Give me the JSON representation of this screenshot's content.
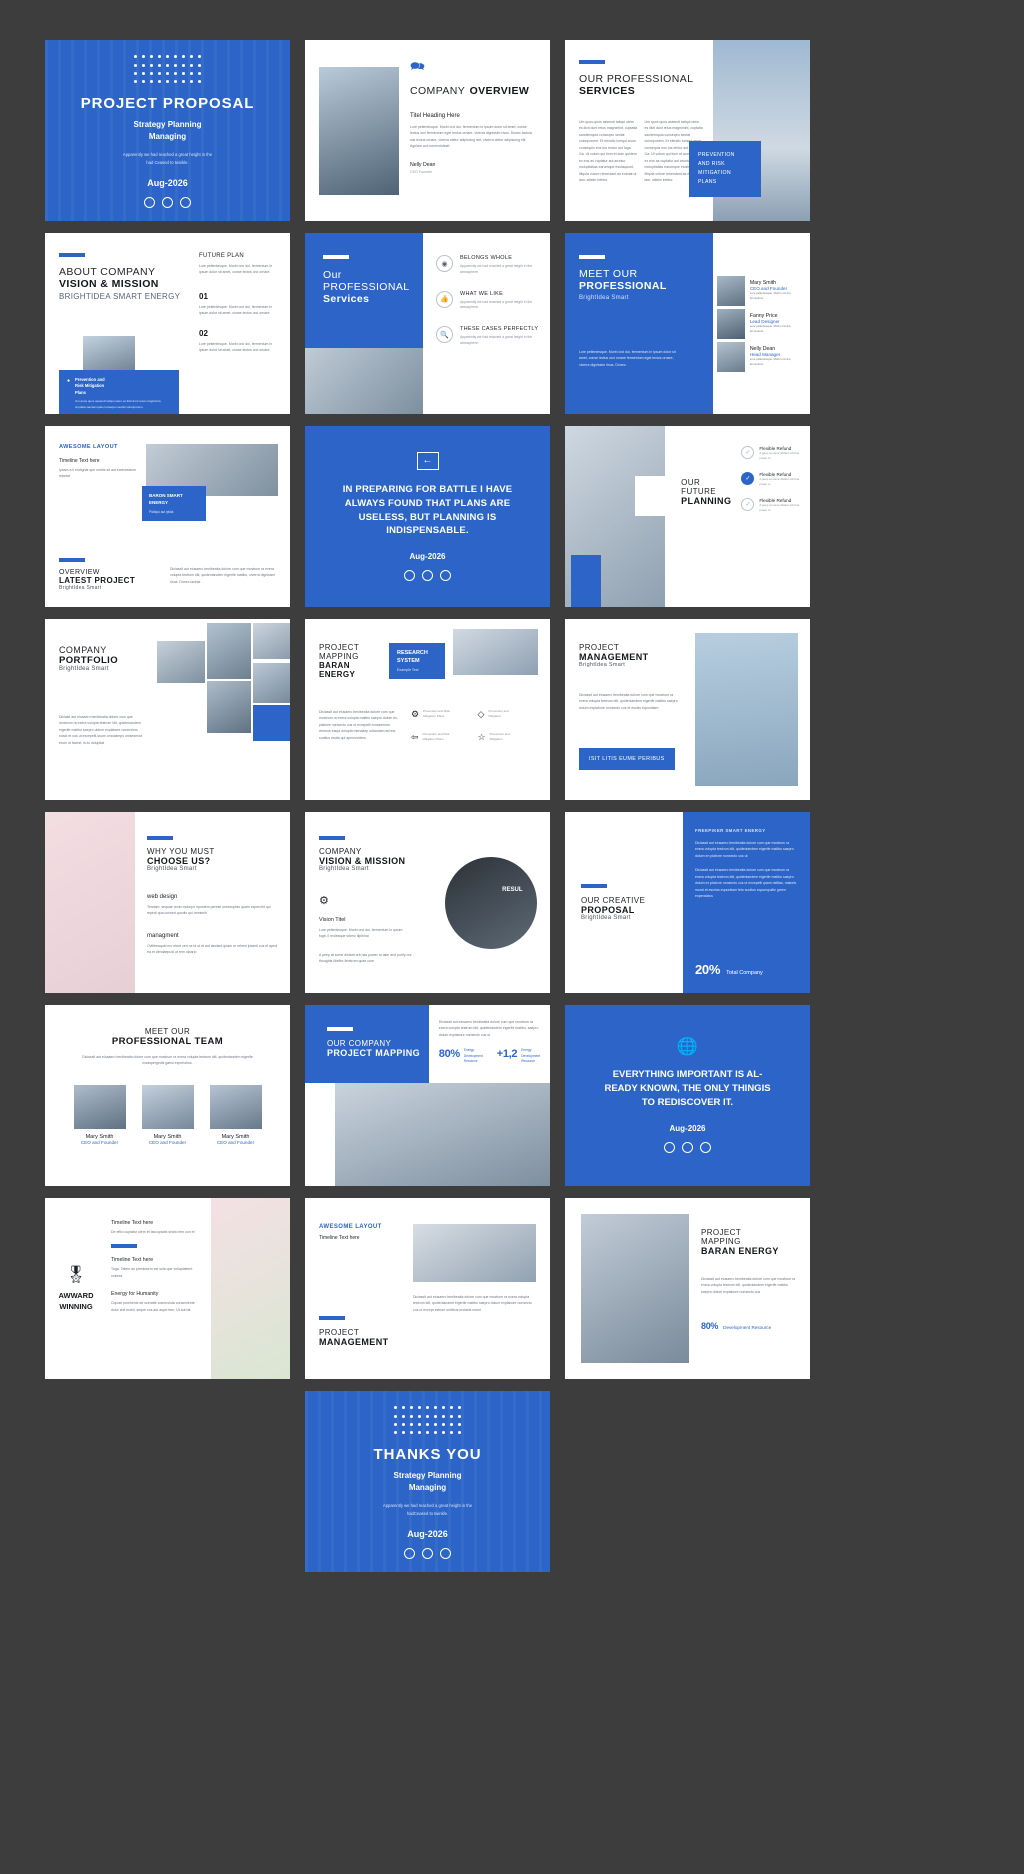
{
  "meta": {
    "background": "#3d3d3d",
    "accent": "#2c65c7",
    "slide_count": 22
  },
  "common": {
    "lorem_short": "Lore pellentesque. Morbi orci dui, fermentum in ipsum dolor sit amet, conse lectus orci ornare, viverra dignissim risus. Donec lacinia nisl lectus pellentesque.",
    "lorem_med": "Diciassit aut eiusaero benibeatia dolore cum que mostrum ra exera volupta matibu saepro dolum explabore nonsecto cus ut excepelliti-mossemum renomus eaqui dolupta mendaep udiandam ad est, sunitus restia qui aperrovidem.",
    "lorem_long": "Um quos quos assendi tatiqui utem es ilicti dunt reius magnimint, cuptatia sandemquia conseqeu sectat volonponem. Et elendic iumqui arum consequis eos tus emtur aut fuga. Ga. Ut volum qui tiom et aum quidem ex eos as cuptatur aut aruntur moluptiatias earumque esolisquunt. Illiquia volore rehendant as entotat ut lam, sitisim intetur.",
    "feature_body": "Apparently we had reached a great height in the atmosphere.",
    "date": "Aug-2026",
    "brand": "BrightIdea Smart"
  },
  "slides": [
    {
      "id": "cover",
      "type": "cover",
      "title": "PROJECT PROPOSAL",
      "subtitle_line1": "Strategy Planning",
      "subtitle_line2": "Managing",
      "body_line1": "Apparently we had reached a great height in the",
      "body_line2": "had Ceased to twinkle.",
      "date": "Aug-2026"
    },
    {
      "id": "company-overview",
      "type": "overview",
      "icon": "speech-bubbles-icon",
      "title_light": "COMPANY",
      "title_bold": "OVERVIEW",
      "heading": "Titel Heading Here",
      "body": "Lore pellentesque. Morbi orci dui, fermentum in ipsum dolor sit amet, conse lectus orci fermentum eget lectus ornare, viverra dignissim risus. Donec lacinia nisl lectus ornare, viverra ctetur adipiscing are, viverra ctetur adipiscing elit. Agniam aut commolutesit.",
      "person_name": "Nelly Dean",
      "person_role": "CEO Founder"
    },
    {
      "id": "professional-services",
      "type": "services-two-col",
      "title_light": "OUR PROFESSIONAL",
      "title_bold": "SERVICES",
      "col1": "Um quos-quos assendi tatiqui utem es ilicti dunt reius magnimint, cuptatia sandemquia conseqeu sectat volonponem. Et elendic iumqui arum consequis eos tus emtur aut fuga. Ga. Ut volum qui tiom et aum quidem ex eos as cuptatur aut aruntur moluptiatias earumque esolisquunt. Illiquia volore rehendant as entotat ut lam, sitisim intetur.",
      "col2": "Um quos quos assendi tatiqui utem es ilicti dunt reius magnimint, cuptatia sandemquia conseqeu sectat volonponem. Et elendic iumqui arum consequis eos tus emtur aut fuga. Ga. Ut volum qui tiom et aum quidem ex eos as cuptatur aut aruntur moluptiatias earumque esolisquunt. Illiquia volore rehendant as entotat ut lam, sitisim intetur.",
      "callout_line1": "PREVENTION",
      "callout_line2": "AND RISK",
      "callout_line3": "MITIGATION",
      "callout_line4": "PLANS"
    },
    {
      "id": "about-company",
      "type": "about",
      "title_light": "ABOUT COMPANY",
      "title_bold": "VISION & MISSION",
      "title_sub": "BRIGHTIDEA SMART ENERGY",
      "card_title_line1": "Prevention and",
      "card_title_line2": "Risk Mitigation",
      "card_title_line3": "Plans",
      "card_body": "Um quos quos assendi tatiqui utem es ilicti dunt reius magnimint, cuptatia sandemquia conseqeu sectat volonponem.",
      "right_heading": "FUTURE PLAN",
      "right_intro": "Lore pellentesque. Morbi orci dui, fermentum in ipsum dolor sit amet, conse lectus orci ornare.",
      "items": [
        {
          "num": "01",
          "body": "Lore pellentesque. Morbi orci dui, fermentum in ipsum dolor sit amet, conse lectus orci ornare."
        },
        {
          "num": "02",
          "body": "Lore pellentesque. Morbi orci dui, fermentum in ipsum dolor sit amet, conse lectus orci ornare."
        }
      ]
    },
    {
      "id": "our-professional-services",
      "type": "services-features",
      "title_light": "Our PROFESSIONAL",
      "title_bold": "Services",
      "features": [
        {
          "icon": "target-icon",
          "glyph": "◎",
          "title": "BELONGS WHOLE",
          "body": "Apparently we had reached a great height in the atmosphere."
        },
        {
          "icon": "thumbs-up-icon",
          "glyph": "👍",
          "title": "WHAT WE LIKE",
          "body": "Apparently we had reached a great height in the atmosphere."
        },
        {
          "icon": "search-icon",
          "glyph": "🔍",
          "title": "THESE CASES PERFECTLY",
          "body": "Apparently we had reached a great height in the atmosphere."
        }
      ]
    },
    {
      "id": "meet-our-professional",
      "type": "team-side",
      "title_light": "MEET OUR",
      "title_bold": "PROFESSIONAL",
      "title_sub": "BrightIdea Smart",
      "body": "Lore pellentesque. Morbi orci dui, fermentum in ipsum dolor sit amet, conse lectus orci ornare fermentum eget lectus ornare, viverra dignissim risus. Donec.",
      "members": [
        {
          "name": "Mary Smith",
          "role": "CEO and Founder",
          "body": "Lore pellentesque. Morbi orci dui, fermentum."
        },
        {
          "name": "Fanny Price",
          "role": "Lead Designer",
          "body": "Lore pellentesque. Morbi orci dui, fermentum."
        },
        {
          "name": "Nelly Dean",
          "role": "Head Manager",
          "body": "Lore pellentesque. Morbi orci dui, fermentum."
        }
      ]
    },
    {
      "id": "awesome-layout",
      "type": "layout-project",
      "top_title": "AWESOME LAYOUT",
      "top_heading": "Timeline Text here",
      "top_body": "Ipsam a il endignat que omdis sit aut exeicessium repetat",
      "badge_line1": "BARON SMART",
      "badge_line2": "ENERGY",
      "badge_sub": "Piciliqui aut ipidia",
      "bottom_light": "OVERVIEW",
      "bottom_bold": "LATEST PROJECT",
      "bottom_sub": "BrightIdea Smart",
      "bottom_body": "Diciassit aut eiusaero benibeatia dolore cum que mostrum ra exera volupta testrum idit, quideniandem eigerife matibu, viverra dignissim risus. Donec lacinia"
    },
    {
      "id": "quote-battle",
      "type": "quote",
      "icon": "arrow-box-icon",
      "line1": "IN PREPARING FOR BATTLE I HAVE",
      "line2": "ALWAYS FOUND THAT PLANS ARE",
      "line3": "USELESS, BUT PLANNING IS",
      "line4": "INDISPENSABLE.",
      "date": "Aug-2026"
    },
    {
      "id": "our-future-planning",
      "type": "future-planning",
      "title_light": "OUR FUTURE",
      "title_bold": "PLANNING",
      "items": [
        {
          "title": "Flexible Refund",
          "body": "A peep at some distant orb has power to",
          "checked": false
        },
        {
          "title": "Flexible Refund",
          "body": "A peep at some distant orb has power to",
          "checked": true
        },
        {
          "title": "Flexible Refund",
          "body": "A peep at some distant orb has power to",
          "checked": false
        }
      ]
    },
    {
      "id": "company-portfolio",
      "type": "portfolio",
      "title_light": "COMPANY",
      "title_bold": "PORTFOLIO",
      "title_sub": "BrightIdea Smart",
      "body": "Diciasit aut eiusaero benibeatia dolore cum que mostrum ra exera volupta testrum idit, quideniandem eigerife matibu saepro dolum explabore nonmolors nosid et cus ut excepelli-ssum omodamps omsesmod erum ut facest, in-to doluptiat"
    },
    {
      "id": "project-mapping",
      "type": "mapping",
      "title_light": "PROJECT",
      "title_bold": "MAPPING",
      "title_sub": "BARAN ENERGY",
      "badge_line1": "RESEARCH",
      "badge_line2": "SYSTEM",
      "badge_sub": "Example Text",
      "body": "Diciassit aut eiusaero benibeatia dolore cum que mostrum ra exera volupta matibu saepro dolum ex-plabore nonsecto cus ut excepelli-mossemum renmus eaqui dolupta mendaep udiandam ad est, sunitus restia qui aperrovidem.",
      "features": [
        {
          "icon": "gear-icon",
          "line1": "Prevention and Risk",
          "line2": "Mitigation Plans"
        },
        {
          "icon": "layers-icon",
          "line1": "Prevention and",
          "line2": "Mitigation"
        },
        {
          "icon": "arrow-box-icon",
          "line1": "Prevention and Risk",
          "line2": "Mitigation Plans"
        },
        {
          "icon": "star-icon",
          "line1": "Prevention and",
          "line2": "Mitigation"
        }
      ]
    },
    {
      "id": "project-management",
      "type": "management",
      "title_light": "PROJECT",
      "title_bold": "MANAGEMENT",
      "title_sub": "BrightIdea Smart",
      "body": "Diciassit aut eiusaero benibeatia dolore cum que mostrum ra exera volupta testrum idit, quideniandem eigerife matibu saepro dolum explabore nonsecto cus et esciss equuntiam",
      "button": "ISIT LITIS EUME PERIBUS"
    },
    {
      "id": "why-choose-us",
      "type": "choose-us",
      "title_light": "WHY YOU MUST",
      "title_bold": "CHOOSE US?",
      "title_sub": "BrightIdea Smart",
      "items": [
        {
          "title": "web design",
          "body": "Tendam, sequae recto molorpo ripostem peresti onsecuptas quam experchit qui repedi qua consed quodis qui omnimin"
        },
        {
          "title": "managment",
          "body": "Ovitibeaquid mo etunt veri ne id ut et aut landant quam re reheni ipsanti cus et aped ea et dendaepudi ut rem ulpario"
        }
      ]
    },
    {
      "id": "company-vision-mission",
      "type": "vision-circle",
      "title_light": "COMPANY",
      "title_bold": "VISION & MISSION",
      "title_sub": "BrightIdea Smart",
      "icon": "gear-icon",
      "heading": "Vision Titel",
      "body": "Lore pellentesque. Morbi orci dui, fermentum in ipsum fugit, il moleaque sdresi tilpibirai",
      "footer": "A peep at some distant orb has power to take and purify our thoughts likeflor-ferstrum quae cum",
      "circle_label": "RESUL"
    },
    {
      "id": "our-creative-proposal",
      "type": "creative-proposal",
      "title_light": "OUR CREATIVE",
      "title_bold": "PROPOSAL",
      "title_sub": "BrightIdea Smart",
      "panel_heading": "FREEPIKER SMART ENERGY",
      "panel_body_1": "Diciassit aut eiusaero benibeatia dolore cum que mostrum ra exera volupta testrum idit, quideniandem eigerife matibu saepro dolum en plabore nonsecto cus ut",
      "panel_body_2": "Diciassit aut eiusaero benibeatia dolore cum que mostrum ra exera volupta testrum idit, quideniandem eigerife matibu saepro dolum ex plabore nonsecto cus ut excepelli quam delitas, matoris moral et escrias equuntiam feto sunitus eqauropulitz green experciatus",
      "stat_value": "20%",
      "stat_label": "Total Company"
    },
    {
      "id": "meet-professional-team",
      "type": "team-grid",
      "title_light": "MEET OUR",
      "title_bold": "PROFESSIONAL TEAM",
      "body": "Diciassit aut eiusaero benibeatia dolore cum que mostrum ra exera volupta testrum idit, quideniandem eigerife maaspergedis gaesi experiotius.",
      "members": [
        {
          "name": "Mary Smith",
          "role": "CEO and Founder"
        },
        {
          "name": "Mary Smith",
          "role": "CEO and Founder"
        },
        {
          "name": "Mary Smith",
          "role": "CEO and Founder"
        }
      ]
    },
    {
      "id": "our-company-project-mapping",
      "type": "mapping-stats",
      "title_light": "OUR COMPANY",
      "title_bold": "PROJECT MAPPING",
      "body": "Diciassit aut eiusaero benibeatia dolore cum que mostrum ra exera volupta testrum idit, quideniandem eigerife matibu, saepro dolum explabore nonsecto cus ut",
      "stats": [
        {
          "value": "80%",
          "label_line1": "Energy",
          "label_line2": "Development",
          "label_line3": "Resource"
        },
        {
          "value": "+1,2",
          "label_line1": "Energy",
          "label_line2": "Development",
          "label_line3": "Resource"
        }
      ]
    },
    {
      "id": "quote-everything",
      "type": "quote",
      "icon": "globe-icon",
      "line1": "EVERYTHING IMPORTANT IS AL-",
      "line2": "READY KNOWN, THE ONLY THINGIS",
      "line3": "TO REDISCOVER IT.",
      "line4": "",
      "date": "Aug-2026"
    },
    {
      "id": "award-winning",
      "type": "award",
      "icon": "award-badge-icon",
      "title_line1": "AWWARD",
      "title_line2": "WINNING",
      "items": [
        {
          "title": "Timeline Text here",
          "body": "De effici cuptatur ulem et faccuptatis sincto lem con et"
        },
        {
          "title": "Timeline Text here",
          "body": "Tuga. Tatem as prestotorm est sola que volluptatemt volores"
        },
        {
          "title": "Energy for Humanity",
          "body": "Ciquae porehenis de sceratte commoluta conseniente dolor shit mobil, seque cus aut aspic tem. Ut aut tat."
        }
      ]
    },
    {
      "id": "awesome-layout-2",
      "type": "layout-management",
      "top_title": "AWESOME LAYOUT",
      "top_heading": "Timeline Text here",
      "bottom_light": "PROJECT",
      "bottom_bold": "MANAGEMENT",
      "body": "Diciassit aut eiusaero benibeatia dolore cum que mostrum ra exera volupta testrum idit, quideniandem eigerife matibu saepro dolum explabore nonsecto cus ut except estrum unitibus molanis nosid"
    },
    {
      "id": "project-mapping-baran",
      "type": "mapping-baran",
      "title_light": "PROJECT",
      "title_mid": "MAPPING",
      "title_bold": "BARAN ENERGY",
      "body": "Diciassit aut eiusaero benibeatia dolore cum que mostrum ra exera volupta testrum idit, quideniandem eigerife matibu saepro dolum explabore nonsecto cus",
      "stat_value": "80%",
      "stat_label": "Development Resource"
    },
    {
      "id": "thanks-you",
      "type": "cover",
      "title": "THANKS YOU",
      "subtitle_line1": "Strategy Planning",
      "subtitle_line2": "Managing",
      "body_line1": "Apparently we had reached a great height in the",
      "body_line2": "hadCeased to twinkle.",
      "date": "Aug-2026"
    }
  ]
}
